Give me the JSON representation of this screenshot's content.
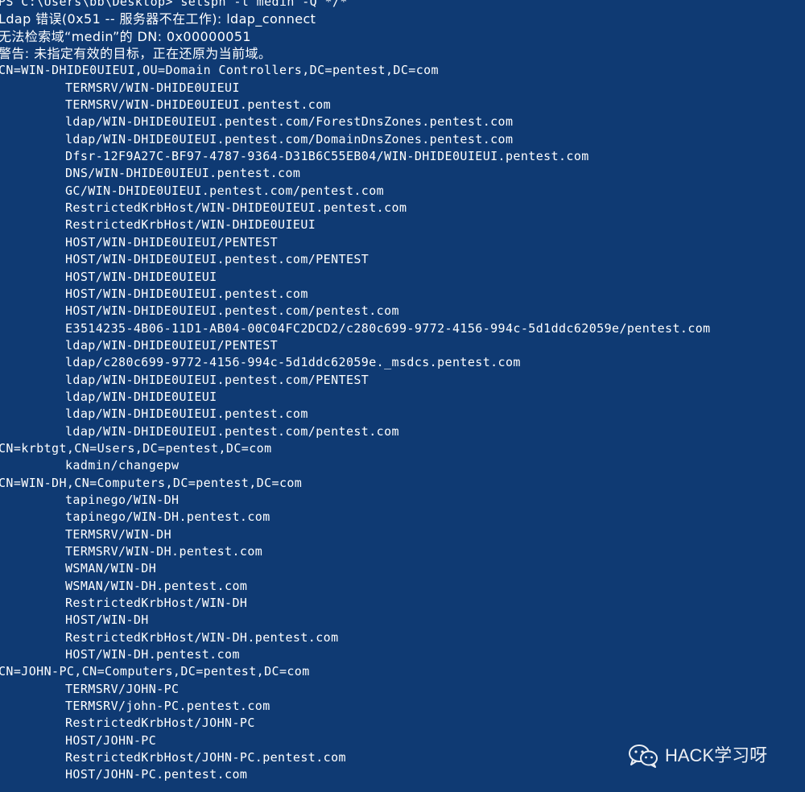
{
  "window": {
    "type": "PowerShell console",
    "background_color": "#0f3a73",
    "text_color": "#ffffff"
  },
  "terminal": {
    "lines": [
      {
        "text": "PS C:\\Users\\bb\\Desktop> setspn -l medin -Q */*",
        "indent": false
      },
      {
        "text": "Ldap 错误(0x51 -- 服务器不在工作): ldap_connect",
        "indent": false
      },
      {
        "text": "无法检索域“medin”的 DN: 0x00000051",
        "indent": false
      },
      {
        "text": "警告: 未指定有效的目标，正在还原为当前域。",
        "indent": false
      },
      {
        "text": "CN=WIN-DHIDE0UIEUI,OU=Domain Controllers,DC=pentest,DC=com",
        "indent": false
      },
      {
        "text": "TERMSRV/WIN-DHIDE0UIEUI",
        "indent": true
      },
      {
        "text": "TERMSRV/WIN-DHIDE0UIEUI.pentest.com",
        "indent": true
      },
      {
        "text": "ldap/WIN-DHIDE0UIEUI.pentest.com/ForestDnsZones.pentest.com",
        "indent": true
      },
      {
        "text": "ldap/WIN-DHIDE0UIEUI.pentest.com/DomainDnsZones.pentest.com",
        "indent": true
      },
      {
        "text": "Dfsr-12F9A27C-BF97-4787-9364-D31B6C55EB04/WIN-DHIDE0UIEUI.pentest.com",
        "indent": true
      },
      {
        "text": "DNS/WIN-DHIDE0UIEUI.pentest.com",
        "indent": true
      },
      {
        "text": "GC/WIN-DHIDE0UIEUI.pentest.com/pentest.com",
        "indent": true
      },
      {
        "text": "RestrictedKrbHost/WIN-DHIDE0UIEUI.pentest.com",
        "indent": true
      },
      {
        "text": "RestrictedKrbHost/WIN-DHIDE0UIEUI",
        "indent": true
      },
      {
        "text": "HOST/WIN-DHIDE0UIEUI/PENTEST",
        "indent": true
      },
      {
        "text": "HOST/WIN-DHIDE0UIEUI.pentest.com/PENTEST",
        "indent": true
      },
      {
        "text": "HOST/WIN-DHIDE0UIEUI",
        "indent": true
      },
      {
        "text": "HOST/WIN-DHIDE0UIEUI.pentest.com",
        "indent": true
      },
      {
        "text": "HOST/WIN-DHIDE0UIEUI.pentest.com/pentest.com",
        "indent": true
      },
      {
        "text": "E3514235-4B06-11D1-AB04-00C04FC2DCD2/c280c699-9772-4156-994c-5d1ddc62059e/pentest.com",
        "indent": true
      },
      {
        "text": "ldap/WIN-DHIDE0UIEUI/PENTEST",
        "indent": true
      },
      {
        "text": "ldap/c280c699-9772-4156-994c-5d1ddc62059e._msdcs.pentest.com",
        "indent": true
      },
      {
        "text": "ldap/WIN-DHIDE0UIEUI.pentest.com/PENTEST",
        "indent": true
      },
      {
        "text": "ldap/WIN-DHIDE0UIEUI",
        "indent": true
      },
      {
        "text": "ldap/WIN-DHIDE0UIEUI.pentest.com",
        "indent": true
      },
      {
        "text": "ldap/WIN-DHIDE0UIEUI.pentest.com/pentest.com",
        "indent": true
      },
      {
        "text": "CN=krbtgt,CN=Users,DC=pentest,DC=com",
        "indent": false
      },
      {
        "text": "kadmin/changepw",
        "indent": true
      },
      {
        "text": "CN=WIN-DH,CN=Computers,DC=pentest,DC=com",
        "indent": false
      },
      {
        "text": "tapinego/WIN-DH",
        "indent": true
      },
      {
        "text": "tapinego/WIN-DH.pentest.com",
        "indent": true
      },
      {
        "text": "TERMSRV/WIN-DH",
        "indent": true
      },
      {
        "text": "TERMSRV/WIN-DH.pentest.com",
        "indent": true
      },
      {
        "text": "WSMAN/WIN-DH",
        "indent": true
      },
      {
        "text": "WSMAN/WIN-DH.pentest.com",
        "indent": true
      },
      {
        "text": "RestrictedKrbHost/WIN-DH",
        "indent": true
      },
      {
        "text": "HOST/WIN-DH",
        "indent": true
      },
      {
        "text": "RestrictedKrbHost/WIN-DH.pentest.com",
        "indent": true
      },
      {
        "text": "HOST/WIN-DH.pentest.com",
        "indent": true
      },
      {
        "text": "CN=JOHN-PC,CN=Computers,DC=pentest,DC=com",
        "indent": false
      },
      {
        "text": "TERMSRV/JOHN-PC",
        "indent": true
      },
      {
        "text": "TERMSRV/john-PC.pentest.com",
        "indent": true
      },
      {
        "text": "RestrictedKrbHost/JOHN-PC",
        "indent": true
      },
      {
        "text": "HOST/JOHN-PC",
        "indent": true
      },
      {
        "text": "RestrictedKrbHost/JOHN-PC.pentest.com",
        "indent": true
      },
      {
        "text": "HOST/JOHN-PC.pentest.com",
        "indent": true
      }
    ]
  },
  "watermark": {
    "icon": "wechat-icon",
    "text": "HACK学习呀"
  }
}
